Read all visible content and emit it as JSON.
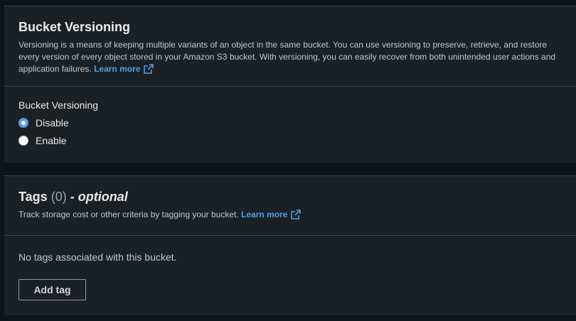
{
  "versioning": {
    "title": "Bucket Versioning",
    "description": "Versioning is a means of keeping multiple variants of an object in the same bucket. You can use versioning to preserve, retrieve, and restore every version of every object stored in your Amazon S3 bucket. With versioning, you can easily recover from both unintended user actions and application failures.",
    "learn_more": "Learn more",
    "field_label": "Bucket Versioning",
    "options": [
      {
        "label": "Disable",
        "selected": true
      },
      {
        "label": "Enable",
        "selected": false
      }
    ]
  },
  "tags": {
    "title": "Tags",
    "count": "(0)",
    "optional": "- optional",
    "description": "Track storage cost or other criteria by tagging your bucket.",
    "learn_more": "Learn more",
    "empty_text": "No tags associated with this bucket.",
    "add_button": "Add tag"
  },
  "colors": {
    "accent": "#539fe5",
    "panel_bg": "#1b2024",
    "page_bg": "#0f1419"
  },
  "icons": {
    "external_link": "external-link-icon"
  }
}
